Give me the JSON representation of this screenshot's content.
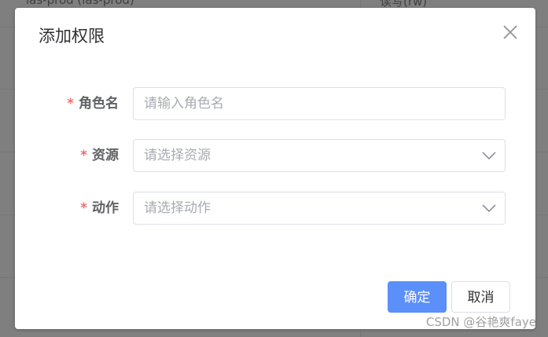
{
  "background": {
    "row_text_left": "ias-prod (ias-prod)",
    "row_text_right": "读写(rw)"
  },
  "dialog": {
    "title": "添加权限",
    "close_icon": "close-icon",
    "fields": {
      "role_name": {
        "required_mark": "*",
        "label": "角色名",
        "placeholder": "请输入角色名",
        "value": ""
      },
      "resource": {
        "required_mark": "*",
        "label": "资源",
        "placeholder": "请选择资源",
        "icon": "chevron-down-icon"
      },
      "action": {
        "required_mark": "*",
        "label": "动作",
        "placeholder": "请选择动作",
        "icon": "chevron-down-icon"
      }
    },
    "buttons": {
      "confirm": "确定",
      "cancel": "取消"
    }
  },
  "watermark": "CSDN @谷艳爽faye",
  "colors": {
    "primary": "#5b8ff9",
    "required": "#f56c6c",
    "overlay": "#7f7f7f"
  }
}
